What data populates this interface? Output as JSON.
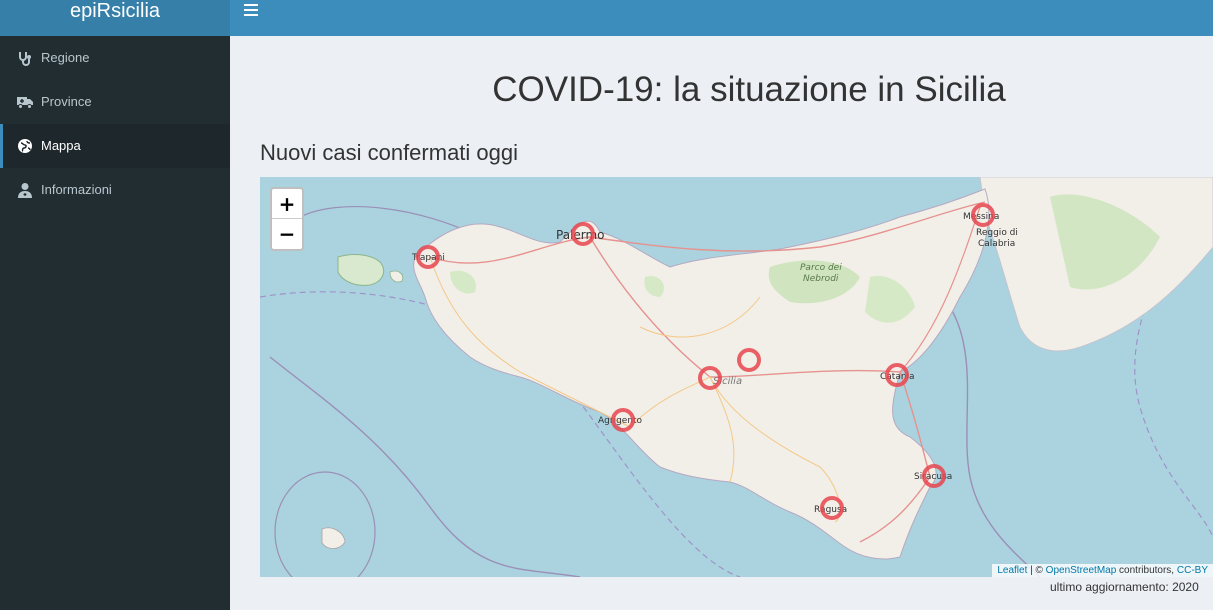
{
  "app": {
    "title": "epiRsicilia"
  },
  "sidebar": {
    "items": [
      {
        "label": "Regione",
        "icon": "stethoscope-icon",
        "active": false
      },
      {
        "label": "Province",
        "icon": "ambulance-icon",
        "active": false
      },
      {
        "label": "Mappa",
        "icon": "globe-icon",
        "active": true
      },
      {
        "label": "Informazioni",
        "icon": "user-doctor-icon",
        "active": false
      }
    ]
  },
  "main": {
    "title": "COVID-19: la situazione in Sicilia",
    "subtitle": "Nuovi casi confermati oggi",
    "updated": "ultimo aggiornamento: 2020"
  },
  "map": {
    "zoom_in": "+",
    "zoom_out": "−",
    "attribution": {
      "leaflet": "Leaflet",
      "sep": " | © ",
      "osm": "OpenStreetMap",
      "contrib": " contributors, ",
      "license": "CC-BY"
    },
    "labels": {
      "trapani": "Trapani",
      "palermo": "Palermo",
      "messina": "Messina",
      "reggio1": "Reggio di",
      "reggio2": "Calabria",
      "nebrodi1": "Parco dei",
      "nebrodi2": "Nebrodi",
      "sicilia": "Sicilia",
      "catania": "Catania",
      "agrigento": "Agrigento",
      "siracusa": "Siracusa",
      "ragusa": "Ragusa"
    },
    "colors": {
      "sea": "#aad3df",
      "land": "#f2efe9",
      "marker": "#e8454f"
    }
  }
}
